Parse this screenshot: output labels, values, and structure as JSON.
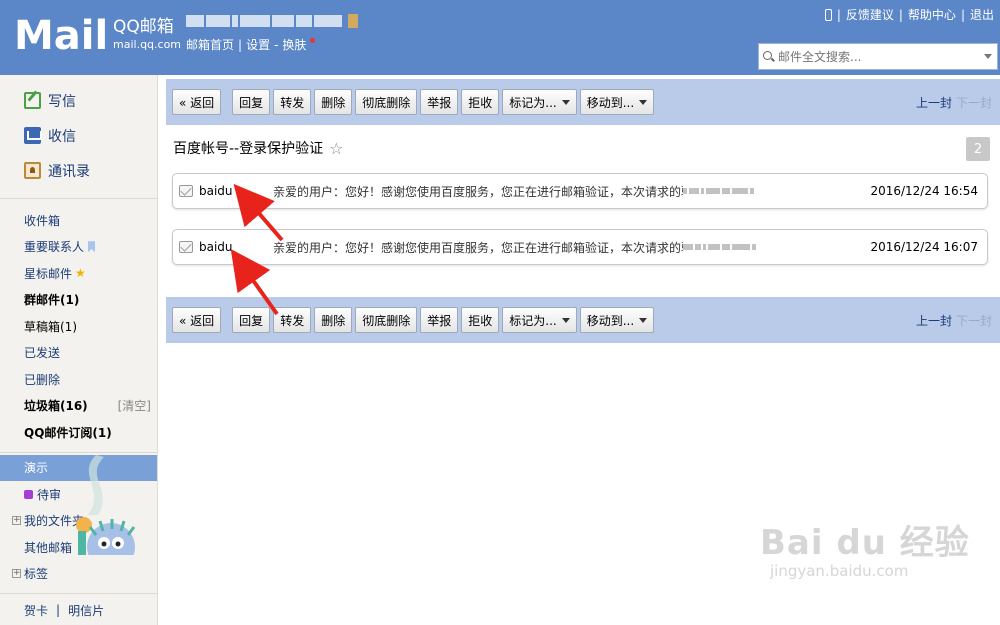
{
  "header": {
    "logo_text": "Mail",
    "brand_name": "QQ邮箱",
    "brand_url": "mail.qq.com",
    "links": [
      "邮箱首页",
      "设置",
      "换肤"
    ],
    "top_links": [
      "反馈建议",
      "帮助中心",
      "退出"
    ],
    "search_placeholder": "邮件全文搜索..."
  },
  "sidebar": {
    "main": [
      {
        "label": "写信",
        "icon": "compose-icon"
      },
      {
        "label": "收信",
        "icon": "inbox-icon"
      },
      {
        "label": "通讯录",
        "icon": "contacts-icon"
      }
    ],
    "folders": {
      "inbox": "收件箱",
      "vip": "重要联系人",
      "starred": "星标邮件",
      "group": "群邮件(1)",
      "drafts": "草稿箱(1)",
      "sent": "已发送",
      "deleted": "已删除",
      "spam": "垃圾箱(16)",
      "spam_clear": "[清空]",
      "subscriptions": "QQ邮件订阅(1)"
    },
    "custom": {
      "demo": "演示",
      "pending": "待审",
      "my_folders": "我的文件夹",
      "other_mailboxes": "其他邮箱",
      "tags": "标签"
    },
    "bottom": [
      "贺卡",
      "明信片"
    ]
  },
  "toolbar": {
    "back": "« 返回",
    "reply": "回复",
    "forward": "转发",
    "delete": "删除",
    "delete_permanent": "彻底删除",
    "report": "举报",
    "reject": "拒收",
    "mark_as": "标记为...",
    "move_to": "移动到...",
    "prev": "上一封",
    "next": "下一封"
  },
  "conversation": {
    "subject": "百度帐号--登录保护验证",
    "count": "2",
    "messages": [
      {
        "sender": "baidu",
        "preview": "亲爱的用户：您好！感谢您使用百度服务，您正在进行邮箱验证，本次请求的验证码为：",
        "date": "2016/12/24 16:54"
      },
      {
        "sender": "baidu",
        "preview": "亲爱的用户：您好！感谢您使用百度服务，您正在进行邮箱验证，本次请求的验证码为：",
        "date": "2016/12/24 16:07"
      }
    ]
  },
  "watermark": {
    "brand": "Bai du 经验",
    "url": "jingyan.baidu.com"
  },
  "colors": {
    "header_bg": "#5b86c7",
    "toolbar_bg": "#b9cbe9",
    "sidebar_bg": "#f4f2ee",
    "sidebar_active": "#7aa0d8",
    "arrow": "#e8231b"
  }
}
